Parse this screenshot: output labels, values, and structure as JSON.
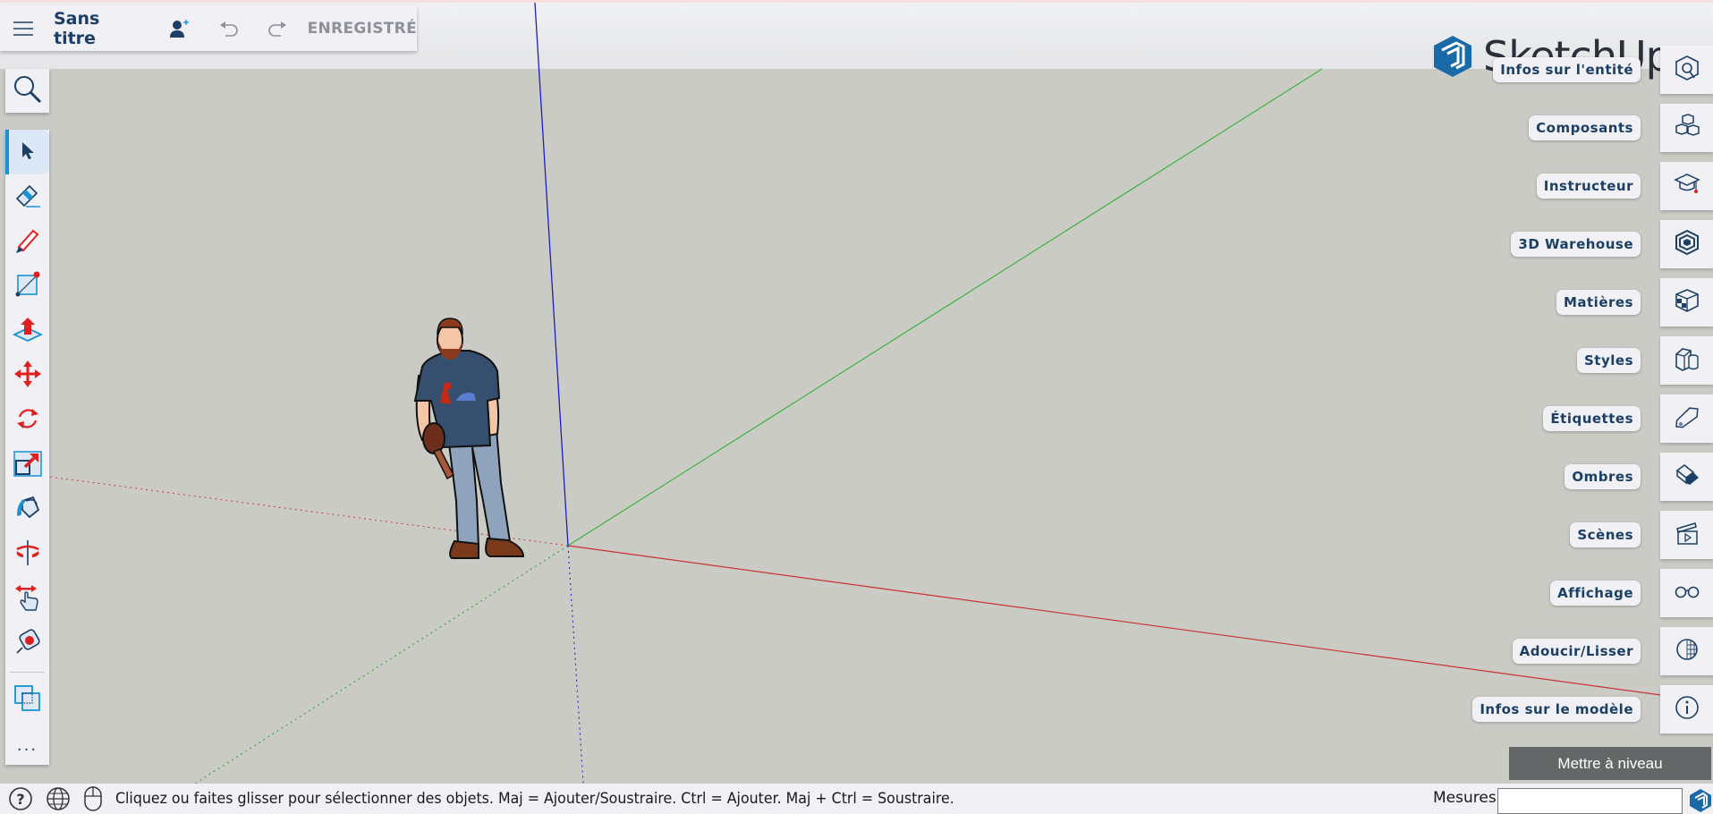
{
  "app": {
    "title": "Sans titre",
    "save_status": "ENREGISTRÉ",
    "brand": "SketchUp"
  },
  "topbar": {
    "icons": [
      "menu-icon",
      "add-user-icon",
      "undo-icon",
      "redo-icon"
    ]
  },
  "left_toolbar": {
    "search_tool": "search-icon",
    "tools": [
      {
        "name": "select",
        "icon": "select-arrow-icon",
        "active": true
      },
      {
        "name": "eraser",
        "icon": "eraser-icon",
        "active": false
      },
      {
        "name": "pencil",
        "icon": "pencil-icon",
        "active": false
      },
      {
        "name": "rectangle",
        "icon": "rectangle-icon",
        "active": false
      },
      {
        "name": "push-pull",
        "icon": "push-pull-icon",
        "active": false
      },
      {
        "name": "move",
        "icon": "move-icon",
        "active": false
      },
      {
        "name": "rotate",
        "icon": "rotate-icon",
        "active": false
      },
      {
        "name": "scale",
        "icon": "scale-icon",
        "active": false
      },
      {
        "name": "paint-bucket",
        "icon": "paint-bucket-icon",
        "active": false
      },
      {
        "name": "orbit",
        "icon": "orbit-icon",
        "active": false
      },
      {
        "name": "pan",
        "icon": "pan-icon",
        "active": false
      },
      {
        "name": "tape-measure",
        "icon": "tape-measure-icon",
        "active": false
      },
      {
        "name": "section",
        "icon": "section-icon",
        "active": false
      }
    ],
    "more_label": "..."
  },
  "right_panels": [
    {
      "label": "Infos sur l'entité",
      "icon": "entity-info-icon"
    },
    {
      "label": "Composants",
      "icon": "components-icon"
    },
    {
      "label": "Instructeur",
      "icon": "instructor-icon"
    },
    {
      "label": "3D Warehouse",
      "icon": "warehouse-icon"
    },
    {
      "label": "Matières",
      "icon": "materials-icon"
    },
    {
      "label": "Styles",
      "icon": "styles-icon"
    },
    {
      "label": "Étiquettes",
      "icon": "tags-icon"
    },
    {
      "label": "Ombres",
      "icon": "shadows-icon"
    },
    {
      "label": "Scènes",
      "icon": "scenes-icon"
    },
    {
      "label": "Affichage",
      "icon": "display-icon"
    },
    {
      "label": "Adoucir/Lisser",
      "icon": "soften-icon"
    },
    {
      "label": "Infos sur le modèle",
      "icon": "model-info-icon"
    }
  ],
  "upgrade_button": "Mettre à niveau",
  "statusbar": {
    "icons": [
      "help-icon",
      "globe-icon",
      "mouse-icon"
    ],
    "hint": "Cliquez ou faites glisser pour sélectionner des objets. Maj = Ajouter/Soustraire. Ctrl = Ajouter. Maj + Ctrl = Soustraire.",
    "measures_label": "Mesures",
    "measures_value": ""
  },
  "colors": {
    "accent": "#1893d1",
    "text_primary": "#1c3f66",
    "axis_red": "#c83232",
    "axis_green": "#3cb43c",
    "axis_blue": "#1e1ec8"
  }
}
